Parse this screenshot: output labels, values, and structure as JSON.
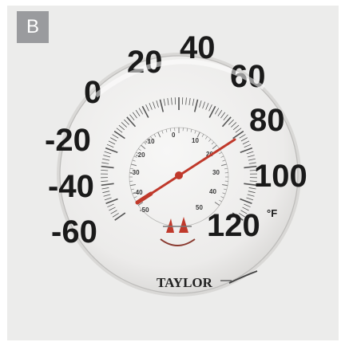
{
  "panel": {
    "label": "B"
  },
  "thermometer": {
    "brand": "TAYLOR",
    "fahrenheit_labels": [
      "-60",
      "-40",
      "-20",
      "0",
      "20",
      "40",
      "60",
      "80",
      "100",
      "120"
    ],
    "unit": "°F",
    "celsius_labels": [
      "-50",
      "-40",
      "-30",
      "-20",
      "-10",
      "0",
      "10",
      "20",
      "30",
      "40",
      "50"
    ],
    "reading_f": 68,
    "colors": {
      "face": "#eeeeec",
      "needle": "#c0392b",
      "text": "#1a1a1a"
    }
  }
}
